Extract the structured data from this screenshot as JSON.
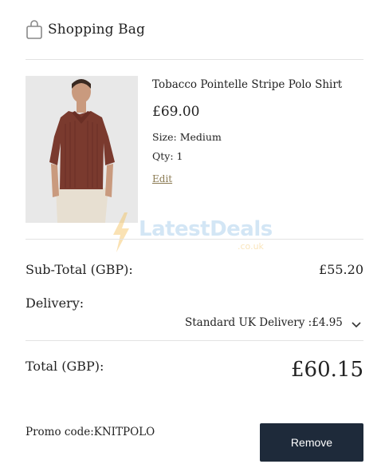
{
  "header": {
    "title": "Shopping Bag",
    "icon": "shopping-bag-icon"
  },
  "product": {
    "name": "Tobacco Pointelle Stripe Polo Shirt",
    "price": "£69.00",
    "size": "Size: Medium",
    "qty": "Qty: 1",
    "edit_label": "Edit",
    "shirt_color": "#7a3a2e"
  },
  "watermark": {
    "brand": "LatestDeals",
    "suffix": ".co.uk"
  },
  "summary": {
    "subtotal_label": "Sub-Total (GBP):",
    "subtotal_value": "£55.20",
    "delivery_label": "Delivery:",
    "delivery_option": "Standard UK Delivery :£4.95",
    "total_label": "Total (GBP):",
    "total_value": "£60.15"
  },
  "promo": {
    "text": "Promo code:KNITPOLO",
    "remove_label": "Remove"
  },
  "colors": {
    "button_bg": "#1e2a3a",
    "edit_link": "#8a7a52"
  }
}
